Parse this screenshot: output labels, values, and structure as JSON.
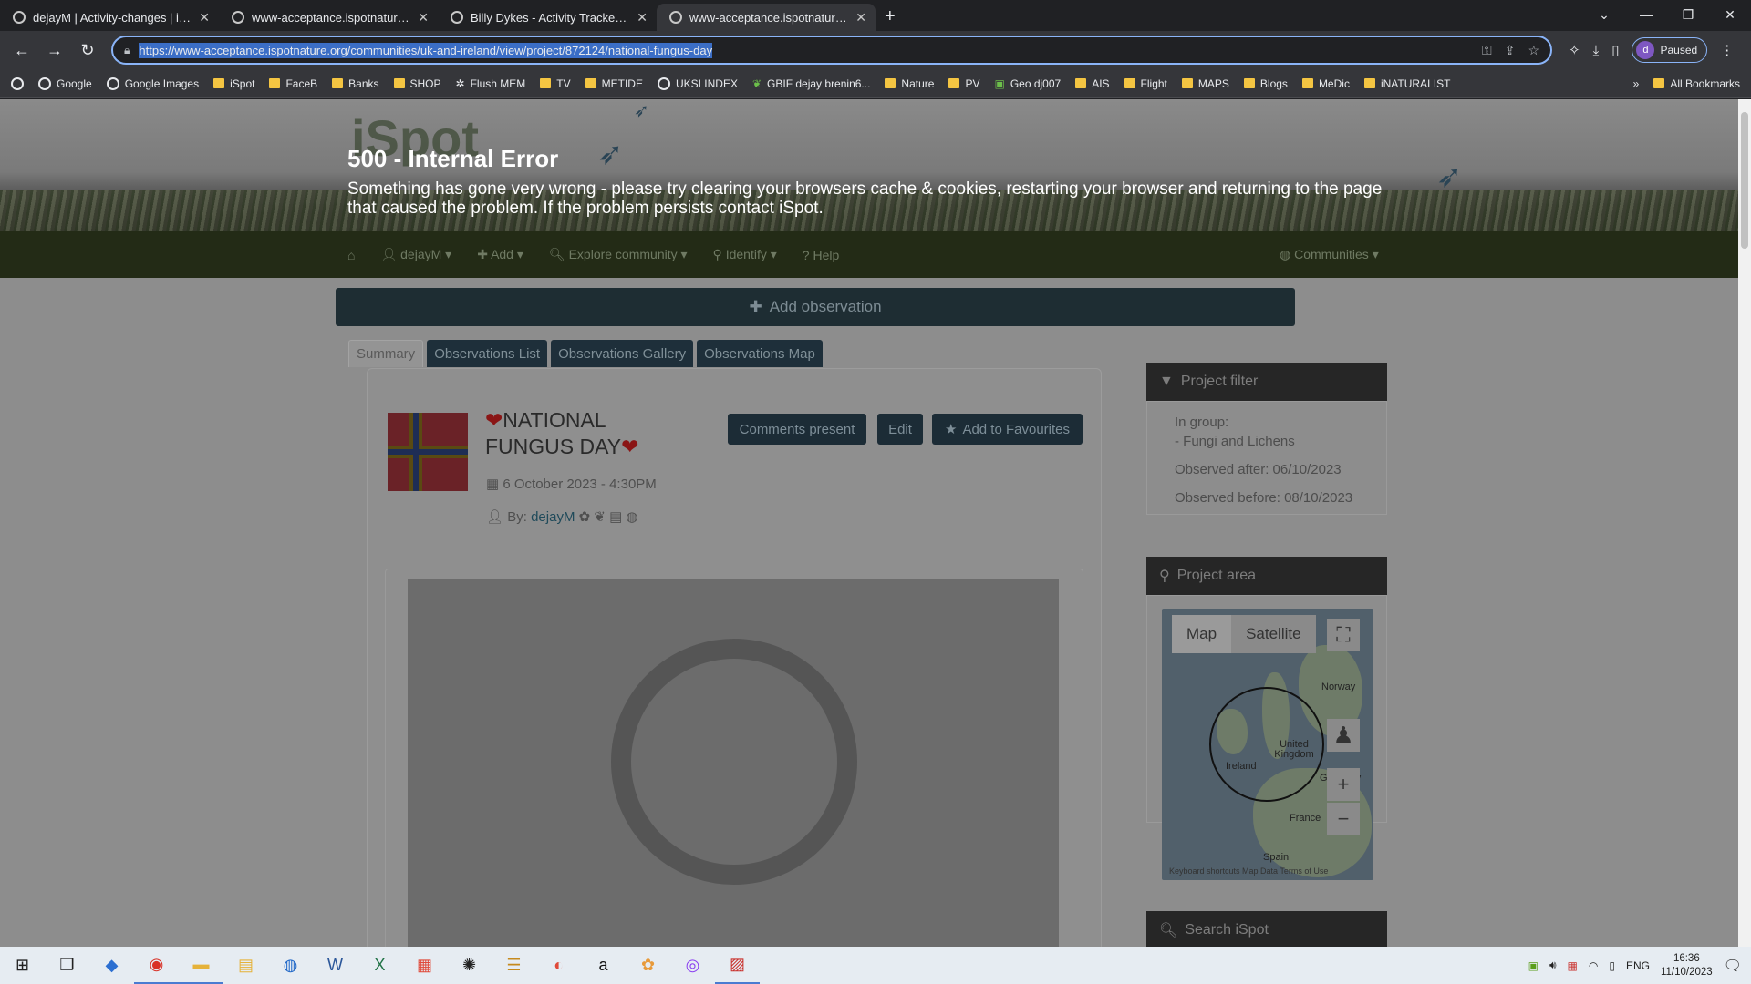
{
  "browser": {
    "tabs": [
      {
        "title": "dejayM | Activity-changes | iSpot",
        "active": false
      },
      {
        "title": "www-acceptance.ispotnature.org",
        "active": false
      },
      {
        "title": "Billy Dykes - Activity Tracker | Us",
        "active": false
      },
      {
        "title": "www-acceptance.ispotnature.org",
        "active": true
      }
    ],
    "url": "https://www-acceptance.ispotnature.org/communities/uk-and-ireland/view/project/872124/national-fungus-day",
    "profile_initial": "d",
    "profile_status": "Paused",
    "bookmarks": [
      "Google",
      "Google Images",
      "iSpot",
      "FaceB",
      "Banks",
      "SHOP",
      "Flush MEM",
      "TV",
      "METIDE",
      "UKSI INDEX",
      "GBIF dejay brenin6...",
      "Nature",
      "PV",
      "Geo dj007",
      "AIS",
      "Flight",
      "MAPS",
      "Blogs",
      "MeDic",
      "iNATURALIST"
    ],
    "all_bookmarks": "All Bookmarks"
  },
  "page": {
    "error_title": "500 - Internal Error",
    "error_message": "Something has gone very wrong - please try clearing your browsers cache & cookies, restarting your browser and returning to the page that caused the problem. If the problem persists contact iSpot.",
    "logo_text": "iSpot",
    "nav": {
      "user": "dejayM",
      "add": "Add",
      "explore": "Explore community",
      "identify": "Identify",
      "help": "Help",
      "communities": "Communities"
    },
    "add_observation": "Add observation",
    "tabs": [
      "Summary",
      "Observations List",
      "Observations Gallery",
      "Observations Map"
    ],
    "project": {
      "title_line1": "NATIONAL",
      "title_line2": "FUNGUS DAY",
      "date": "6 October 2023 - 4:30PM",
      "by_label": "By:",
      "by_user": "dejayM"
    },
    "actions": {
      "comments": "Comments present",
      "edit": "Edit",
      "favourites": "Add to Favourites"
    },
    "filter": {
      "heading": "Project filter",
      "in_group_label": "In group:",
      "in_group_value": "- Fungi and Lichens",
      "observed_after": "Observed after: 06/10/2023",
      "observed_before": "Observed before: 08/10/2023"
    },
    "area": {
      "heading": "Project area",
      "map_tab": "Map",
      "satellite_tab": "Satellite",
      "labels": {
        "norway": "Norway",
        "uk": "United Kingdom",
        "ireland": "Ireland",
        "germany": "Germany",
        "france": "France",
        "spain": "Spain"
      },
      "footer": "Keyboard shortcuts   Map Data   Terms of Use"
    },
    "search_heading": "Search iSpot"
  },
  "taskbar": {
    "lang": "ENG",
    "time": "16:36",
    "date": "11/10/2023"
  }
}
